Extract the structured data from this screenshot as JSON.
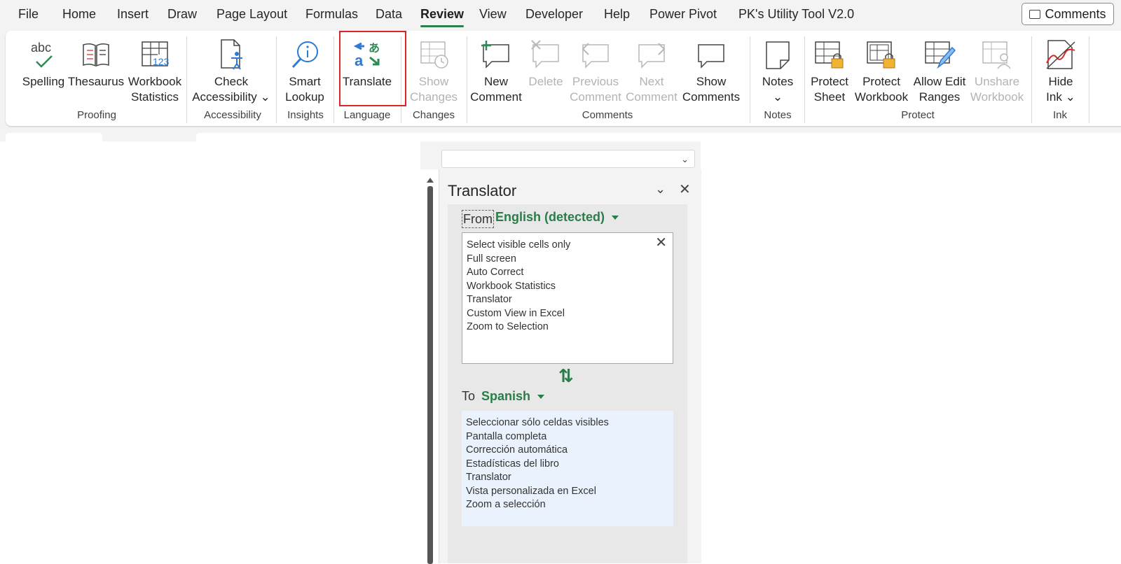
{
  "menu": {
    "tabs": [
      "File",
      "Home",
      "Insert",
      "Draw",
      "Page Layout",
      "Formulas",
      "Data",
      "Review",
      "View",
      "Developer",
      "Help",
      "Power Pivot",
      "PK's Utility Tool V2.0"
    ],
    "active_tab": "Review",
    "comments_button": "Comments"
  },
  "ribbon": {
    "buttons": {
      "spelling": "Spelling",
      "thesaurus": "Thesaurus",
      "workbook_statistics": "Workbook\nStatistics",
      "check_accessibility": "Check\nAccessibility ⌄",
      "smart_lookup": "Smart\nLookup",
      "translate": "Translate",
      "show_changes": "Show\nChanges",
      "new_comment": "New\nComment",
      "delete": "Delete",
      "previous_comment": "Previous\nComment",
      "next_comment": "Next\nComment",
      "show_comments": "Show\nComments",
      "notes": "Notes\n⌄",
      "protect_sheet": "Protect\nSheet",
      "protect_workbook": "Protect\nWorkbook",
      "allow_edit_ranges": "Allow Edit\nRanges",
      "unshare_workbook": "Unshare\nWorkbook",
      "hide_ink": "Hide\nInk ⌄"
    },
    "groups": {
      "proofing": "Proofing",
      "accessibility": "Accessibility",
      "insights": "Insights",
      "language": "Language",
      "changes": "Changes",
      "comments": "Comments",
      "notes": "Notes",
      "protect": "Protect",
      "ink": "Ink"
    },
    "icon_spelling_text": "abc",
    "icon_stats_text": "123"
  },
  "translator": {
    "title": "Translator",
    "from_label": "From",
    "from_language": "English (detected)",
    "source_lines": [
      "Select visible cells only",
      "Full screen",
      "Auto Correct",
      "Workbook Statistics",
      "Translator",
      "Custom View in Excel",
      "Zoom to Selection"
    ],
    "to_label": "To",
    "to_language": "Spanish",
    "target_lines": [
      "Seleccionar sólo celdas visibles",
      "Pantalla completa",
      "Corrección automática",
      "Estadísticas del libro",
      "Translator",
      "Vista personalizada en Excel",
      "Zoom a selección"
    ]
  },
  "colors": {
    "accent_green": "#2a7d49",
    "highlight_red": "#d9262b",
    "target_bg": "#eaf3fd"
  },
  "icons": [
    "spelling-icon",
    "thesaurus-icon",
    "workbook-statistics-icon",
    "check-accessibility-icon",
    "smart-lookup-icon",
    "translate-icon",
    "show-changes-icon",
    "new-comment-icon",
    "delete-comment-icon",
    "previous-comment-icon",
    "next-comment-icon",
    "show-comments-icon",
    "notes-icon",
    "protect-sheet-icon",
    "protect-workbook-icon",
    "allow-edit-ranges-icon",
    "unshare-workbook-icon",
    "hide-ink-icon",
    "collapse-icon",
    "close-icon",
    "swap-icon"
  ]
}
